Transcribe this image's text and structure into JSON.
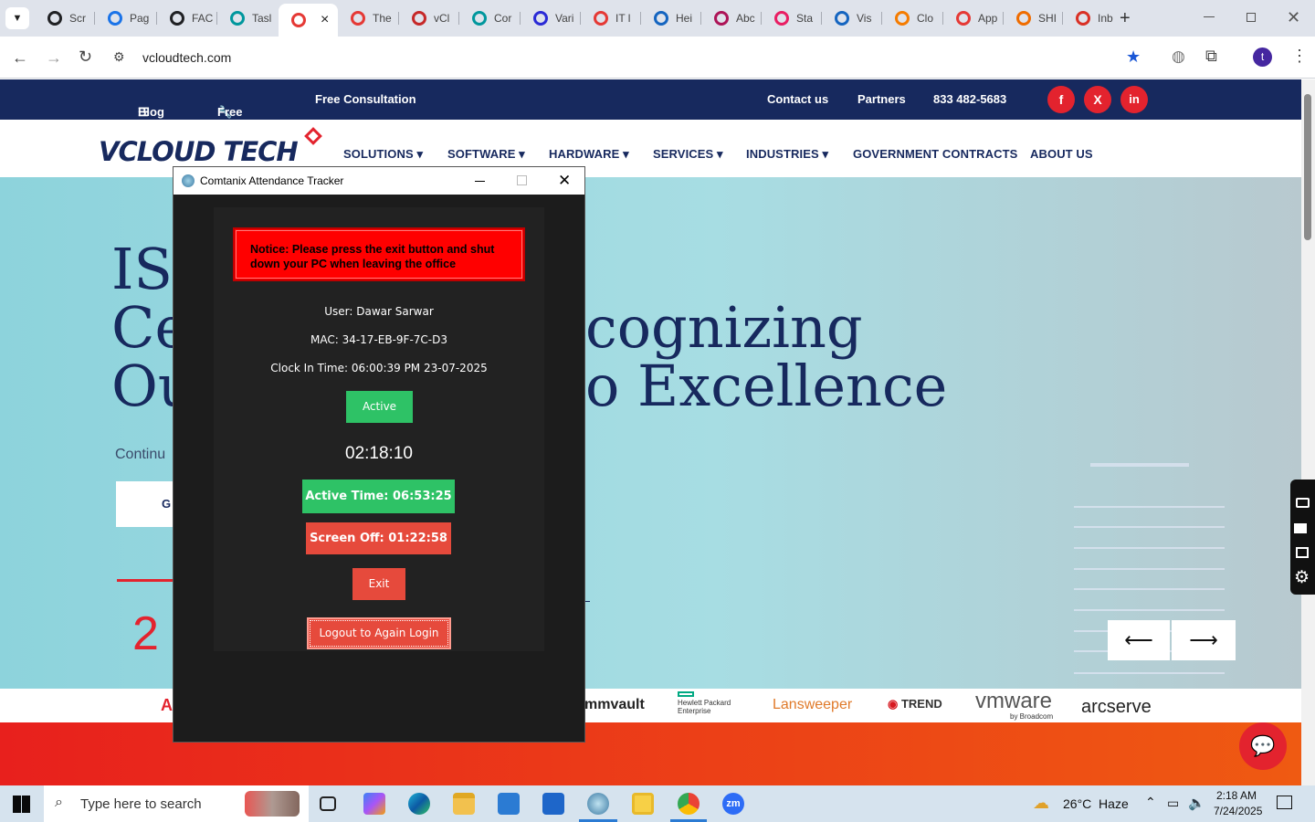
{
  "browser": {
    "tabs": [
      {
        "label": "Scr",
        "color": "#202124"
      },
      {
        "label": "Pag",
        "color": "#1a73e8"
      },
      {
        "label": "FAC",
        "color": "#202124"
      },
      {
        "label": "Tasl",
        "color": "#00979d"
      },
      {
        "label": "",
        "color": "#e53935",
        "active": true
      },
      {
        "label": "The",
        "color": "#e53935"
      },
      {
        "label": "vCl",
        "color": "#c62828"
      },
      {
        "label": "Cor",
        "color": "#00979d"
      },
      {
        "label": "Vari",
        "color": "#2b2bd6"
      },
      {
        "label": "IT l",
        "color": "#e53935"
      },
      {
        "label": "Hei",
        "color": "#1565c0"
      },
      {
        "label": "Abc",
        "color": "#ad1457"
      },
      {
        "label": "Sta",
        "color": "#e91e63"
      },
      {
        "label": "Vis",
        "color": "#1565c0"
      },
      {
        "label": "Clo",
        "color": "#f57c00"
      },
      {
        "label": "App",
        "color": "#e53935"
      },
      {
        "label": "SHI",
        "color": "#ef6c00"
      },
      {
        "label": "Inb",
        "color": "#d93025"
      }
    ],
    "tab_close": "×",
    "new_tab": "+",
    "url": "vcloudtech.com",
    "profile_initial": "t"
  },
  "site": {
    "topbar": {
      "blog": "Blog",
      "free_tools": "Free Tools",
      "free_consultation": "Free Consultation",
      "contact": "Contact us",
      "partners": "Partners",
      "phone": "833 482-5683",
      "social": [
        "f",
        "X",
        "in"
      ]
    },
    "logo": "VCLOUD TECH",
    "nav": [
      "SOLUTIONS",
      "SOFTWARE",
      "HARDWARE",
      "SERVICES",
      "INDUSTRIES",
      "GOVERNMENT CONTRACTS",
      "ABOUT US"
    ],
    "hero": {
      "line1": "IS",
      "line2a": "Ce",
      "line2b": "cognizing",
      "line3a": "Ou",
      "line3b": "o Excellence",
      "continue": "Continu",
      "button": "G",
      "number": "2"
    },
    "partners": [
      "A",
      "mmvault",
      "Hewlett Packard Enterprise",
      "Lansweeper",
      "TREND",
      "vmware",
      "by Broadcom",
      "arcserve"
    ]
  },
  "popup": {
    "title": "Comtanix Attendance Tracker",
    "notice": "Notice: Please press the exit button and shut down your PC when leaving the office",
    "user": "User: Dawar Sarwar",
    "mac": "MAC: 34-17-EB-9F-7C-D3",
    "clock_in": "Clock In Time: 06:00:39 PM 23-07-2025",
    "status": "Active",
    "timer": "02:18:10",
    "active_time": "Active Time: 06:53:25",
    "screen_off": "Screen Off: 01:22:58",
    "exit": "Exit",
    "logout": "Logout to Again Login"
  },
  "taskbar": {
    "search_placeholder": "Type here to search",
    "weather": "26°C  Haze",
    "time": "2:18 AM",
    "date": "7/24/2025"
  }
}
